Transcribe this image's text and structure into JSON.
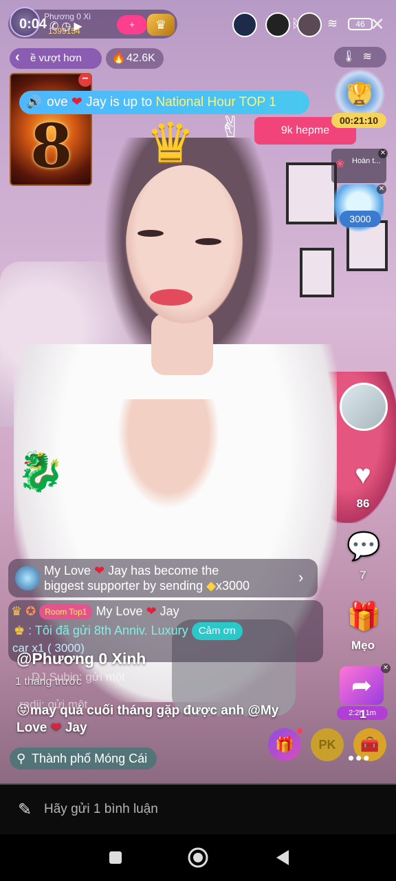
{
  "status_bar": {
    "time": "0:04",
    "battery": "46",
    "close_symbol": "✕"
  },
  "host": {
    "name": "Phương 0 Xi",
    "coins": "1399154",
    "follow_symbol": "+",
    "crown_icon": "crown-badge-icon"
  },
  "top_left": {
    "rank_text": "ề vượt hơn",
    "hot_count": "42.6K"
  },
  "pk_card": {
    "number": "8",
    "minus_symbol": "−"
  },
  "banner": {
    "prefix": "ove",
    "heart": "❤",
    "middle": " Jay is up to ",
    "highlight": "National Hour TOP 1"
  },
  "pink_tag": {
    "text": "9k hepme"
  },
  "trophy": {
    "timer": "00:21:10"
  },
  "task": {
    "label": "Hoàn t..."
  },
  "coin_badge": {
    "value": "3000"
  },
  "right_rail": {
    "like_count": "86",
    "comment_count": "7",
    "tips_label": "Mẹo",
    "share_count": "1",
    "gift_timer": "2:2h 1m"
  },
  "chat": {
    "supporter_line1_name": "My Love",
    "supporter_line1_rest": " Jay has become the",
    "supporter_line2": "biggest supporter by sending ",
    "supporter_amount": "x3000",
    "gift_badge": "Room Top1",
    "gift_sender": "My Love",
    "gift_sender2": " Jay",
    "gift_text": ": Tôi đã gửi 8th Anniv. Luxury",
    "thanks_label": "Cảm ơn",
    "gift_line3": "car x1 (  3000)",
    "host_handle": "@Phương 0 Xinh",
    "time_ago": "1 tháng trước",
    "ghost1": "DJ Subin: gửi một",
    "ghost2": "radji: gửi một",
    "caption_text": "may quá cuối tháng gặp được anh  @My Love",
    "caption_heart": "❤",
    "caption_tail": " Jay",
    "location": "Thành phố Móng Cái"
  },
  "bottom_actions": {
    "pk_label": "PK",
    "more_label": "•••"
  },
  "comment_bar": {
    "placeholder": "Hãy gửi 1 bình luận"
  },
  "colors": {
    "banner": "#4fb7ff",
    "pink_tag": "#f0447a",
    "timer": "#f6d35a",
    "thanks": "#2bc8c9"
  }
}
